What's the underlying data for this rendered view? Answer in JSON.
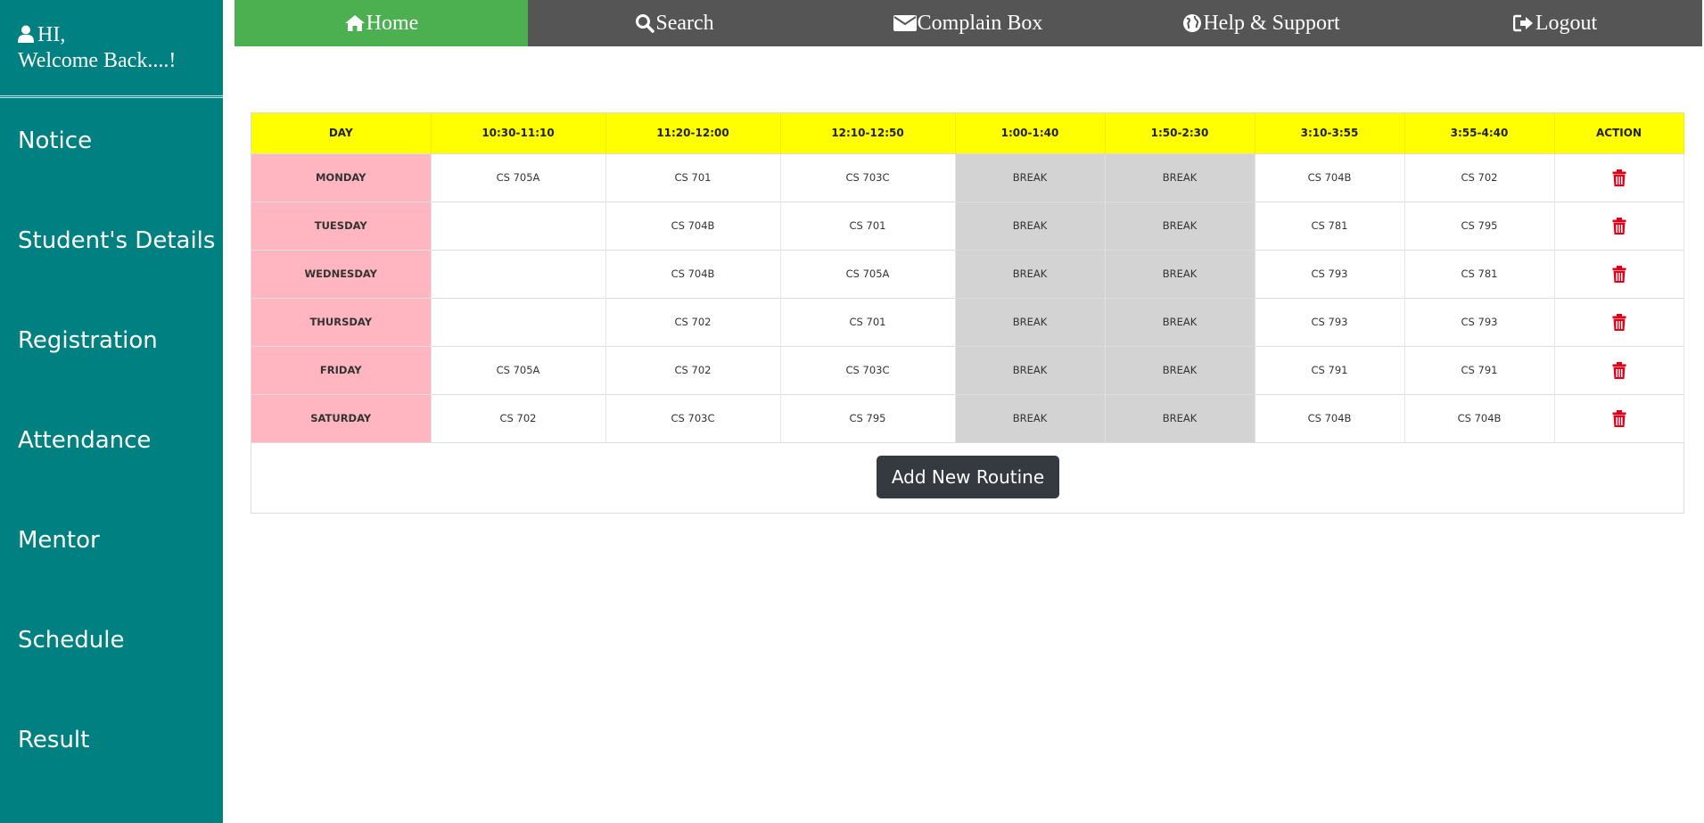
{
  "sidebar": {
    "greeting_line1": "HI,",
    "greeting_line2": "Welcome Back....!",
    "items": [
      {
        "label": "Notice"
      },
      {
        "label": "Student's Details"
      },
      {
        "label": "Registration"
      },
      {
        "label": "Attendance"
      },
      {
        "label": "Mentor"
      },
      {
        "label": "Schedule"
      },
      {
        "label": "Result"
      }
    ]
  },
  "nav": {
    "items": [
      {
        "label": "Home",
        "icon": "home-icon",
        "active": true
      },
      {
        "label": "Search",
        "icon": "search-icon"
      },
      {
        "label": "Complain Box",
        "icon": "envelope-icon"
      },
      {
        "label": "Help & Support",
        "icon": "globe-icon"
      },
      {
        "label": "Logout",
        "icon": "logout-icon"
      }
    ]
  },
  "routine": {
    "headers": [
      "DAY",
      "10:30-11:10",
      "11:20-12:00",
      "12:10-12:50",
      "1:00-1:40",
      "1:50-2:30",
      "3:10-3:55",
      "3:55-4:40",
      "ACTION"
    ],
    "rows": [
      {
        "day": "MONDAY",
        "cells": [
          "CS 705A",
          "CS 701",
          "CS 703C",
          "BREAK",
          "BREAK",
          "CS 704B",
          "CS 702"
        ]
      },
      {
        "day": "TUESDAY",
        "cells": [
          "",
          "CS 704B",
          "CS 701",
          "BREAK",
          "BREAK",
          "CS 781",
          "CS 795"
        ]
      },
      {
        "day": "WEDNESDAY",
        "cells": [
          "",
          "CS 704B",
          "CS 705A",
          "BREAK",
          "BREAK",
          "CS 793",
          "CS 781"
        ]
      },
      {
        "day": "THURSDAY",
        "cells": [
          "",
          "CS 702",
          "CS 701",
          "BREAK",
          "BREAK",
          "CS 793",
          "CS 793"
        ]
      },
      {
        "day": "FRIDAY",
        "cells": [
          "CS 705A",
          "CS 702",
          "CS 703C",
          "BREAK",
          "BREAK",
          "CS 791",
          "CS 791"
        ]
      },
      {
        "day": "SATURDAY",
        "cells": [
          "CS 702",
          "CS 703C",
          "CS 795",
          "BREAK",
          "BREAK",
          "CS 704B",
          "CS 704B"
        ]
      }
    ],
    "action_icon": "trash-icon",
    "add_button": "Add New Routine"
  },
  "colors": {
    "sidebar": "#008080",
    "nav": "#555555",
    "nav_active": "#4caf50",
    "header": "#ffff00",
    "day_cell": "#ffb6c1",
    "break_cell": "#d3d3d3",
    "trash": "#e0001a",
    "button": "#343a40"
  }
}
